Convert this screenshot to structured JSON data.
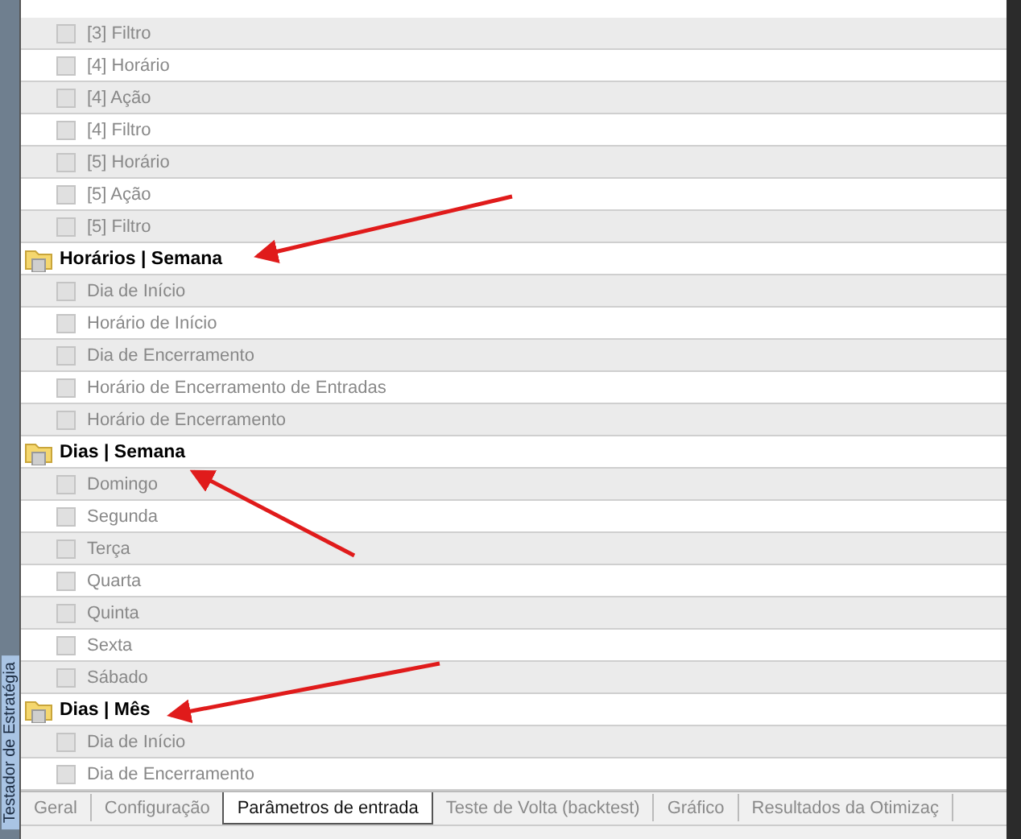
{
  "side_label": "Testador de Estratégia",
  "groups": [
    {
      "items": [
        {
          "label": "[3] Filtro",
          "checked": false,
          "disabled": true
        },
        {
          "label": "[4] Horário",
          "checked": false,
          "disabled": true
        },
        {
          "label": "[4] Ação",
          "checked": false,
          "disabled": true
        },
        {
          "label": "[4] Filtro",
          "checked": false,
          "disabled": true
        },
        {
          "label": "[5] Horário",
          "checked": false,
          "disabled": true
        },
        {
          "label": "[5] Ação",
          "checked": false,
          "disabled": true
        },
        {
          "label": "[5] Filtro",
          "checked": false,
          "disabled": true
        }
      ]
    },
    {
      "title": "Horários | Semana",
      "items": [
        {
          "label": "Dia de Início",
          "checked": false,
          "disabled": true
        },
        {
          "label": "Horário de Início",
          "checked": false,
          "disabled": true
        },
        {
          "label": "Dia de Encerramento",
          "checked": false,
          "disabled": true
        },
        {
          "label": "Horário de Encerramento de Entradas",
          "checked": false,
          "disabled": true
        },
        {
          "label": "Horário de Encerramento",
          "checked": false,
          "disabled": true
        }
      ]
    },
    {
      "title": "Dias | Semana",
      "items": [
        {
          "label": "Domingo",
          "checked": false,
          "disabled": true
        },
        {
          "label": "Segunda",
          "checked": false,
          "disabled": true
        },
        {
          "label": "Terça",
          "checked": false,
          "disabled": true
        },
        {
          "label": "Quarta",
          "checked": false,
          "disabled": true
        },
        {
          "label": "Quinta",
          "checked": false,
          "disabled": true
        },
        {
          "label": "Sexta",
          "checked": false,
          "disabled": true
        },
        {
          "label": "Sábado",
          "checked": false,
          "disabled": true
        }
      ]
    },
    {
      "title": "Dias | Mês",
      "items": [
        {
          "label": "Dia de Início",
          "checked": false,
          "disabled": true
        },
        {
          "label": "Dia de Encerramento",
          "checked": false,
          "disabled": true
        }
      ]
    }
  ],
  "tabs": [
    {
      "label": "Geral",
      "selected": false
    },
    {
      "label": "Configuração",
      "selected": false
    },
    {
      "label": "Parâmetros de entrada",
      "selected": true
    },
    {
      "label": "Teste de Volta (backtest)",
      "selected": false
    },
    {
      "label": "Gráfico",
      "selected": false
    },
    {
      "label": "Resultados da Otimizaç",
      "selected": false
    }
  ]
}
